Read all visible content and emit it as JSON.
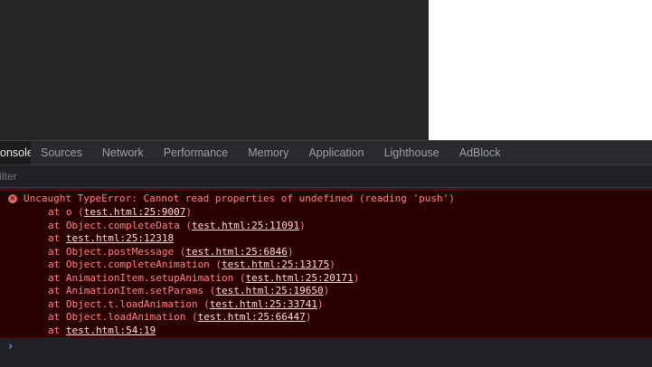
{
  "tabs": [
    {
      "label": "Console",
      "active": true
    },
    {
      "label": "Sources"
    },
    {
      "label": "Network"
    },
    {
      "label": "Performance"
    },
    {
      "label": "Memory"
    },
    {
      "label": "Application"
    },
    {
      "label": "Lighthouse"
    },
    {
      "label": "AdBlock"
    }
  ],
  "filter": {
    "placeholder": "Filter"
  },
  "error": {
    "icon": "error-circle-icon",
    "message": "Uncaught TypeError: Cannot read properties of undefined (reading 'push')",
    "stack": [
      {
        "prefix": "at o (",
        "link": "test.html:25:9007",
        "suffix": ")"
      },
      {
        "prefix": "at Object.completeData (",
        "link": "test.html:25:11091",
        "suffix": ")"
      },
      {
        "prefix": "at ",
        "link": "test.html:25:12318",
        "suffix": ""
      },
      {
        "prefix": "at Object.postMessage (",
        "link": "test.html:25:6846",
        "suffix": ")"
      },
      {
        "prefix": "at Object.completeAnimation (",
        "link": "test.html:25:13175",
        "suffix": ")"
      },
      {
        "prefix": "at AnimationItem.setupAnimation (",
        "link": "test.html:25:20171",
        "suffix": ")"
      },
      {
        "prefix": "at AnimationItem.setParams (",
        "link": "test.html:25:19650",
        "suffix": ")"
      },
      {
        "prefix": "at Object.t.loadAnimation (",
        "link": "test.html:25:33741",
        "suffix": ")"
      },
      {
        "prefix": "at Object.loadAnimation (",
        "link": "test.html:25:66447",
        "suffix": ")"
      },
      {
        "prefix": "at ",
        "link": "test.html:54:19",
        "suffix": ""
      }
    ]
  },
  "prompt": {
    "icon": "chevron-right-icon",
    "glyph": "›"
  },
  "colors": {
    "error_bg": "#290000",
    "error_text": "#ff8080",
    "link_text": "#ffd9d9",
    "prompt": "#8ab4f8"
  }
}
